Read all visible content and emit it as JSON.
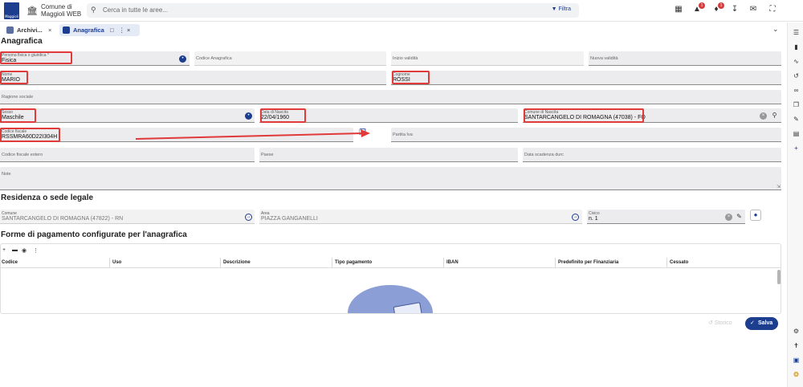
{
  "app": {
    "logo_text": "Maggioli",
    "title_line1": "Comune di",
    "title_line2": "Maggioli WEB",
    "search_placeholder": "Cerca in tutte le aree...",
    "filter_label": "Filtra",
    "notif_badge_1": "1",
    "notif_badge_2": "1"
  },
  "tabs": [
    {
      "label": "Archivi..."
    },
    {
      "label": "Anagrafica"
    }
  ],
  "page_title": "Anagrafica",
  "fields": {
    "persona_label": "Persona fisica o giuridica *",
    "persona_value": "Fisica",
    "codice_anagrafica_label": "Codice Anagrafica",
    "inizio_validita_label": "Inizio validità",
    "nuova_validita_label": "Nuova validità",
    "nome_label": "Nome",
    "nome_value": "MARIO",
    "cognome_label": "Cognome",
    "cognome_value": "ROSSI",
    "ragione_sociale_label": "Ragione sociale",
    "sesso_label": "Sesso",
    "sesso_value": "Maschile",
    "data_nascita_label": "Data di Nascita",
    "data_nascita_value": "22/04/1960",
    "comune_nascita_label": "Comune di Nascita",
    "comune_nascita_value": "SANTARCANGELO DI ROMAGNA (47038) - FO",
    "codice_fiscale_label": "Codice fiscale",
    "codice_fiscale_value": "RSSMRA60D22I304H",
    "partita_iva_label": "Partita Iva",
    "cf_estero_label": "Codice fiscale estero",
    "paese_label": "Paese",
    "scadenza_durc_label": "Data scadenza durc",
    "note_label": "Note"
  },
  "residenza": {
    "title": "Residenza o sede legale",
    "comune_label": "Comune",
    "comune_value": "SANTARCANGELO DI ROMAGNA (47822) - RN",
    "area_label": "Area",
    "area_value": "PIAZZA GANGANELLI",
    "civico_label": "Civico",
    "civico_value": "n. 1"
  },
  "pagamento": {
    "title": "Forme di pagamento configurate per l'anagrafica",
    "columns": [
      "Codice",
      "Uso",
      "Descrizione",
      "Tipo pagamento",
      "IBAN",
      "Predefinito per Finanziaria",
      "Cessato"
    ]
  },
  "actions": {
    "storico_label": "Storico",
    "salva_label": "Salva"
  }
}
